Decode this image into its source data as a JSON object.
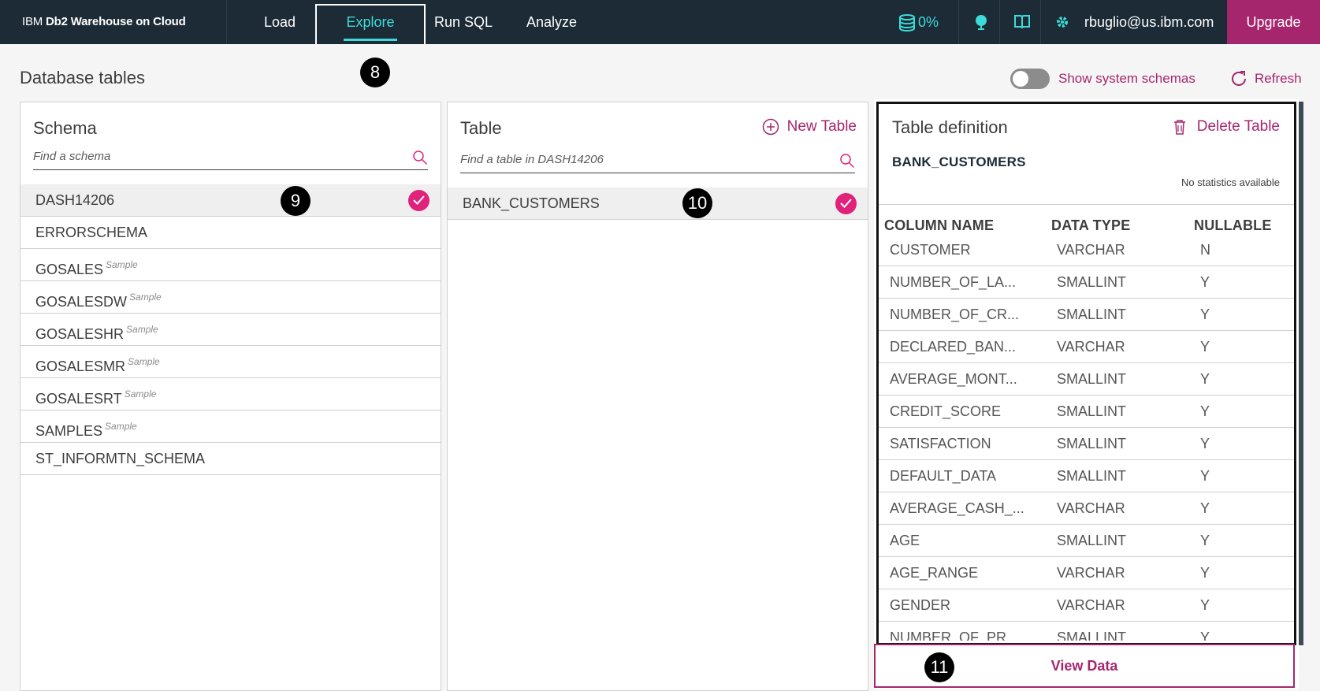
{
  "header": {
    "brand_prefix": "IBM",
    "brand_name": "Db2 Warehouse on Cloud",
    "nav": [
      "Load",
      "Explore",
      "Run SQL",
      "Analyze"
    ],
    "active_nav": "Explore",
    "usage": "0%",
    "user": "rbuglio@us.ibm.com",
    "upgrade": "Upgrade"
  },
  "page": {
    "title": "Database tables",
    "toggle_label": "Show system schemas",
    "toggle_on": false,
    "refresh": "Refresh"
  },
  "callouts": [
    "8",
    "9",
    "10",
    "11"
  ],
  "schema_panel": {
    "title": "Schema",
    "search_placeholder": "Find a schema",
    "items": [
      {
        "name": "DASH14206",
        "tag": "",
        "selected": true
      },
      {
        "name": "ERRORSCHEMA",
        "tag": "",
        "selected": false
      },
      {
        "name": "GOSALES",
        "tag": "Sample",
        "selected": false
      },
      {
        "name": "GOSALESDW",
        "tag": "Sample",
        "selected": false
      },
      {
        "name": "GOSALESHR",
        "tag": "Sample",
        "selected": false
      },
      {
        "name": "GOSALESMR",
        "tag": "Sample",
        "selected": false
      },
      {
        "name": "GOSALESRT",
        "tag": "Sample",
        "selected": false
      },
      {
        "name": "SAMPLES",
        "tag": "Sample",
        "selected": false
      },
      {
        "name": "ST_INFORMTN_SCHEMA",
        "tag": "",
        "selected": false
      }
    ]
  },
  "table_panel": {
    "title": "Table",
    "new_table": "New Table",
    "search_placeholder": "Find a table in DASH14206",
    "items": [
      {
        "name": "BANK_CUSTOMERS",
        "selected": true
      }
    ]
  },
  "definition_panel": {
    "title": "Table definition",
    "delete": "Delete Table",
    "table_name": "BANK_CUSTOMERS",
    "stats": "No statistics available",
    "headers": [
      "COLUMN NAME",
      "DATA TYPE",
      "NULLABLE"
    ],
    "rows": [
      [
        "CUSTOMER",
        "VARCHAR",
        "N"
      ],
      [
        "NUMBER_OF_LA...",
        "SMALLINT",
        "Y"
      ],
      [
        "NUMBER_OF_CR...",
        "SMALLINT",
        "Y"
      ],
      [
        "DECLARED_BAN...",
        "VARCHAR",
        "Y"
      ],
      [
        "AVERAGE_MONT...",
        "SMALLINT",
        "Y"
      ],
      [
        "CREDIT_SCORE",
        "SMALLINT",
        "Y"
      ],
      [
        "SATISFACTION",
        "SMALLINT",
        "Y"
      ],
      [
        "DEFAULT_DATA",
        "SMALLINT",
        "Y"
      ],
      [
        "AVERAGE_CASH_...",
        "VARCHAR",
        "Y"
      ],
      [
        "AGE",
        "SMALLINT",
        "Y"
      ],
      [
        "AGE_RANGE",
        "VARCHAR",
        "Y"
      ],
      [
        "GENDER",
        "VARCHAR",
        "Y"
      ],
      [
        "NUMBER_OF_PR...",
        "SMALLINT",
        "Y"
      ]
    ],
    "view_data": "View Data"
  },
  "colors": {
    "topbar": "#1c2b36",
    "accent_teal": "#3ddbd9",
    "accent_magenta": "#a6266e",
    "check": "#e0227a"
  },
  "icons": [
    "database-icon",
    "globe-icon",
    "book-icon",
    "gear-icon",
    "search-icon",
    "check-icon",
    "plus-circle-icon",
    "trash-icon",
    "refresh-icon"
  ]
}
